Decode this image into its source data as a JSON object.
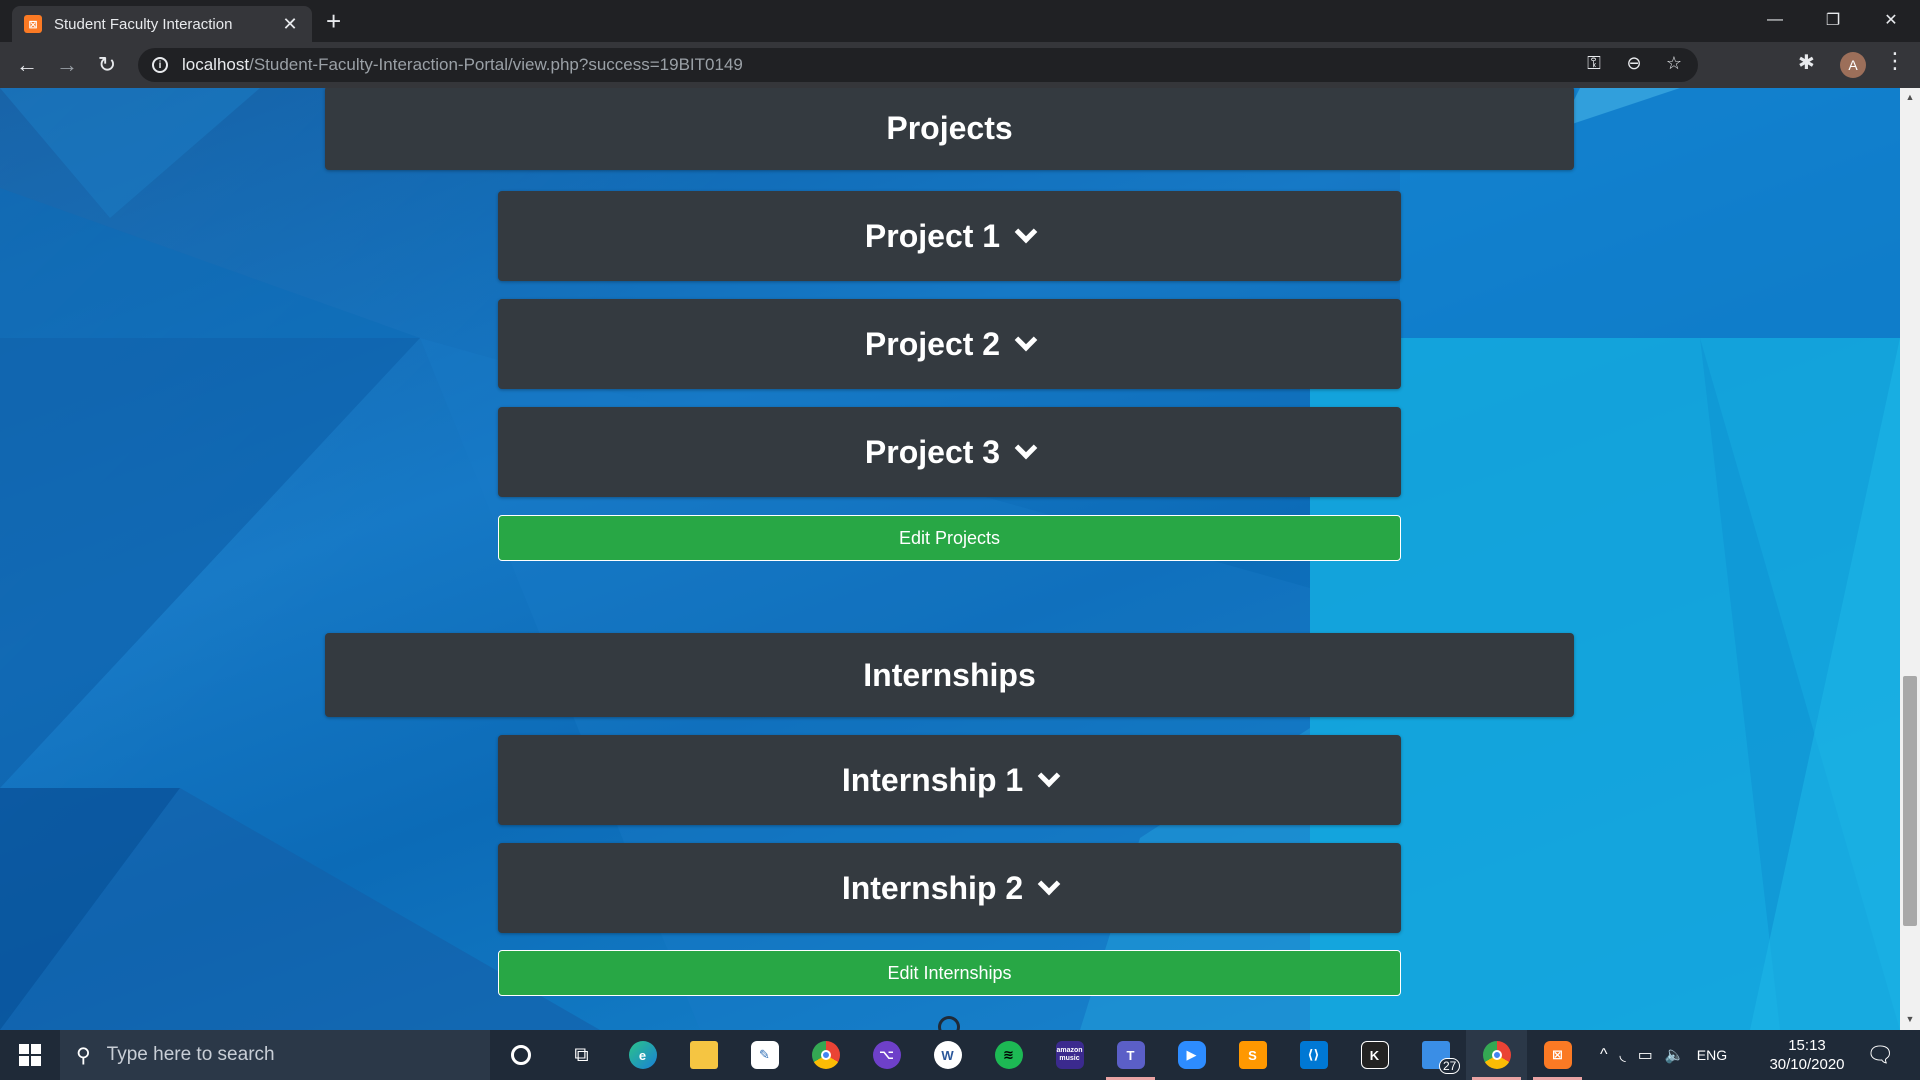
{
  "browser": {
    "tab_title": "Student Faculty Interaction",
    "tab_favicon": "xampp-icon",
    "url_host": "localhost",
    "url_path": "/Student-Faculty-Interaction-Portal/view.php?success=19BIT0149",
    "avatar_letter": "A"
  },
  "projects": {
    "header": "Projects",
    "items": [
      {
        "label": "Project 1"
      },
      {
        "label": "Project 2"
      },
      {
        "label": "Project 3"
      }
    ],
    "edit_label": "Edit Projects"
  },
  "internships": {
    "header": "Internships",
    "items": [
      {
        "label": "Internship 1"
      },
      {
        "label": "Internship 2"
      }
    ],
    "edit_label": "Edit Internships"
  },
  "taskbar": {
    "search_placeholder": "Type here to search",
    "apps": [
      "cortana-icon",
      "task-view-icon",
      "edge-icon",
      "file-explorer-icon",
      "paint-icon",
      "chrome-icon",
      "github-desktop-icon",
      "word-icon",
      "spotify-icon",
      "amazon-music-icon",
      "teams-icon",
      "zoom-icon",
      "sublime-text-icon",
      "vscode-icon",
      "kite-icon",
      "store-icon",
      "chrome-profile-icon",
      "xampp-icon"
    ],
    "amazon_music_label": "amazon music",
    "store_badge": "27",
    "language": "ENG",
    "time": "15:13",
    "date": "30/10/2020"
  },
  "colors": {
    "card": "#343a40",
    "edit_button": "#28a745",
    "background": "#0b5ea8",
    "taskbar": "#1f2a38"
  }
}
